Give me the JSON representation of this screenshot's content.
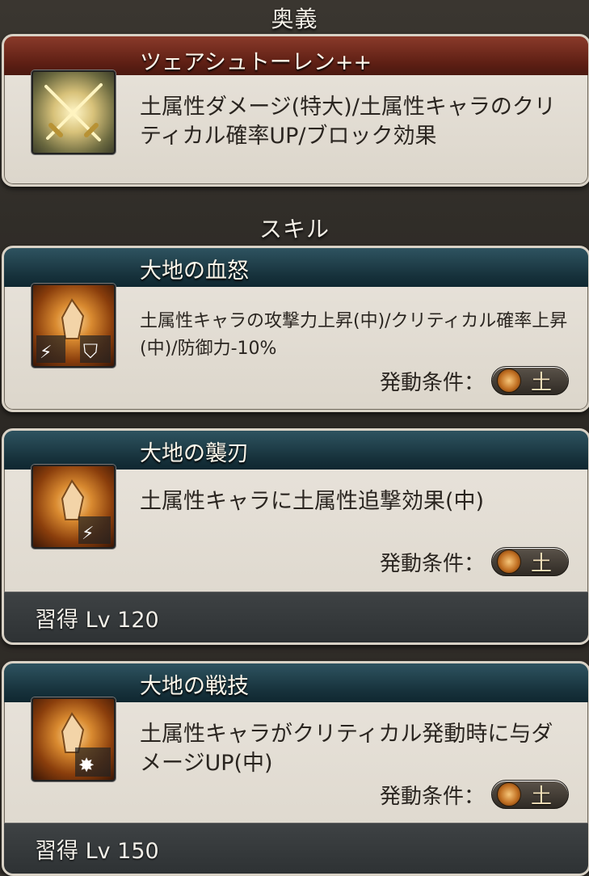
{
  "sections": {
    "ougi_title": "奥義",
    "skill_title": "スキル"
  },
  "ougi": {
    "name": "ツェアシュトーレン++",
    "description": "土属性ダメージ(特大)/土属性キャラのクリティカル確率UP/ブロック効果",
    "icon": "crossed-swords-icon"
  },
  "skills": [
    {
      "name": "大地の血怒",
      "description": "土属性キャラの攻撃力上昇(中)/クリティカル確率上昇(中)/防御力-10%",
      "condition_label": "発動条件：",
      "element": "土",
      "icon": "earth-crystal-icon"
    },
    {
      "name": "大地の襲刃",
      "description": "土属性キャラに土属性追撃効果(中)",
      "condition_label": "発動条件：",
      "element": "土",
      "learn": "習得 Lv 120",
      "icon": "earth-crystal-icon"
    },
    {
      "name": "大地の戦技",
      "description": "土属性キャラがクリティカル発動時に与ダメージUP(中)",
      "condition_label": "発動条件：",
      "element": "土",
      "learn": "習得 Lv 150",
      "icon": "earth-crystal-icon"
    }
  ],
  "colors": {
    "ougi_header": "#5e1f14",
    "skill_header": "#17323c",
    "card_bg": "#e9e4dc"
  }
}
